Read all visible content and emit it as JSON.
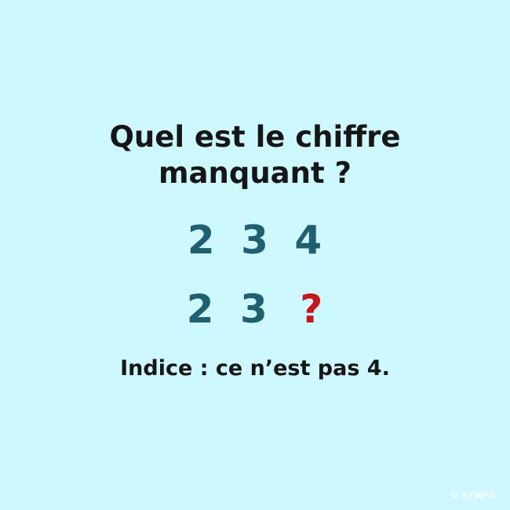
{
  "question": {
    "line1": "Quel est le chiffre",
    "line2": "manquant ?"
  },
  "row1": {
    "d1": "2",
    "d2": "3",
    "d3": "4"
  },
  "row2": {
    "d1": "2",
    "d2": "3",
    "missing": "?"
  },
  "hint": "Indice : ce n’est pas 4.",
  "watermark": "© SYMPA",
  "colors": {
    "background": "#cdf8fd",
    "digits": "#1f5f72",
    "question_mark": "#c8141b",
    "text": "#161616"
  }
}
